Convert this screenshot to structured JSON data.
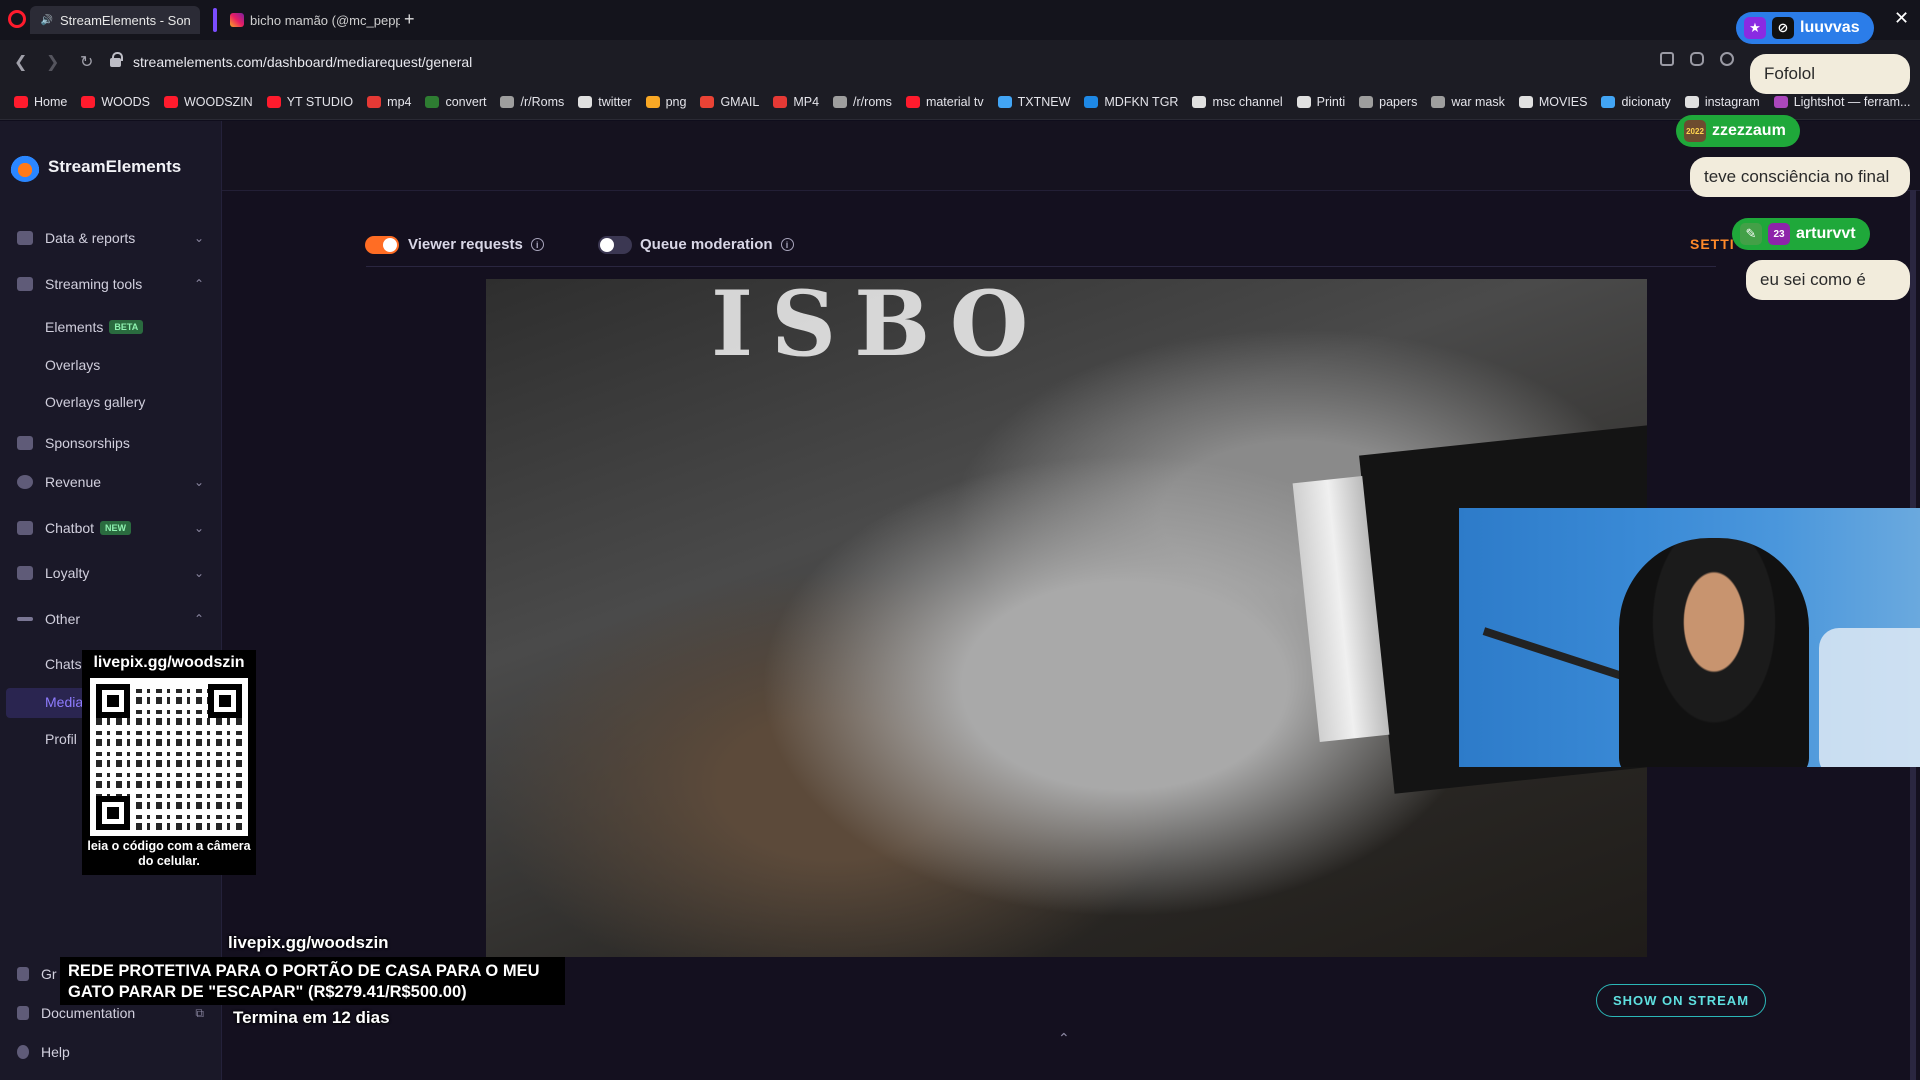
{
  "browser": {
    "tabs": [
      {
        "title": "StreamElements - Son",
        "active": true
      },
      {
        "title": "bicho mamão (@mc_pepp",
        "active": false
      }
    ],
    "new_tab": "+",
    "url": "streamelements.com/dashboard/mediarequest/general",
    "bookmarks": [
      {
        "label": "Home",
        "color": "#ff1b2d"
      },
      {
        "label": "WOODS",
        "color": "#ff1b2d"
      },
      {
        "label": "WOODSZIN",
        "color": "#ff1b2d"
      },
      {
        "label": "YT STUDIO",
        "color": "#ff1b2d"
      },
      {
        "label": "mp4",
        "color": "#e53935"
      },
      {
        "label": "convert",
        "color": "#2e7d32"
      },
      {
        "label": "/r/Roms",
        "color": "#9e9e9e"
      },
      {
        "label": "twitter",
        "color": "#e0e0e0"
      },
      {
        "label": "png",
        "color": "#f9a825"
      },
      {
        "label": "GMAIL",
        "color": "#ea4335"
      },
      {
        "label": "MP4",
        "color": "#e53935"
      },
      {
        "label": "/r/roms",
        "color": "#9e9e9e"
      },
      {
        "label": "material tv",
        "color": "#ff1b2d"
      },
      {
        "label": "TXTNEW",
        "color": "#42a5f5"
      },
      {
        "label": "MDFKN TGR",
        "color": "#1e88e5"
      },
      {
        "label": "msc channel",
        "color": "#e0e0e0"
      },
      {
        "label": "Printi",
        "color": "#e0e0e0"
      },
      {
        "label": "papers",
        "color": "#9e9e9e"
      },
      {
        "label": "war mask",
        "color": "#9e9e9e"
      },
      {
        "label": "MOVIES",
        "color": "#e0e0e0"
      },
      {
        "label": "dicionaty",
        "color": "#42a5f5"
      },
      {
        "label": "instagram",
        "color": "#e0e0e0"
      },
      {
        "label": "Lightshot — ferram...",
        "color": "#ab47bc"
      }
    ],
    "more": "»"
  },
  "dashboard": {
    "brand": "StreamElements",
    "nav": [
      {
        "label": "Data & reports",
        "icon": "chart-icon",
        "chevron": "⌄"
      },
      {
        "label": "Streaming tools",
        "icon": "tools-icon",
        "chevron": "⌃"
      },
      {
        "label": "Sponsorships",
        "icon": "star-icon"
      },
      {
        "label": "Revenue",
        "icon": "dollar-icon",
        "chevron": "⌄"
      },
      {
        "label": "Chatbot",
        "icon": "bot-icon",
        "chevron": "⌄",
        "tag": "NEW"
      },
      {
        "label": "Loyalty",
        "icon": "loyalty-icon",
        "chevron": "⌄"
      },
      {
        "label": "Other",
        "icon": "dots-icon",
        "chevron": "⌃"
      }
    ],
    "streaming_sub": [
      {
        "label": "Elements",
        "tag": "BETA"
      },
      {
        "label": "Overlays"
      },
      {
        "label": "Overlays gallery"
      }
    ],
    "other_sub": [
      {
        "label": "Chats"
      },
      {
        "label": "Media"
      },
      {
        "label": "Profil"
      }
    ],
    "bottom_nav": [
      {
        "label": "Gr"
      },
      {
        "label": "Documentation"
      },
      {
        "label": "Help"
      }
    ],
    "toggles": {
      "viewer_requests": {
        "label": "Viewer requests",
        "on": true
      },
      "queue_moderation": {
        "label": "Queue moderation",
        "on": false
      }
    },
    "settings_label": "SETTI",
    "video_title": "ISBO",
    "show_on_stream": "SHOW ON STREAM",
    "collapse": "⌃"
  },
  "overlay": {
    "qr_url": "livepix.gg/woodszin",
    "qr_caption": "leia o código com a câmera do celular.",
    "goal_url": "livepix.gg/woodszin",
    "goal_text": "REDE PROTETIVA PARA O PORTÃO DE CASA PARA O MEU GATO PARAR DE \"ESCAPAR\" (R$279.41/R$500.00)",
    "goal_ends": "Termina em 12 dias"
  },
  "chat": [
    {
      "user": "luuvvas",
      "message": "Fofolol",
      "color": "#2b7de9"
    },
    {
      "user": "zzezzaum",
      "message": "teve consciência no final",
      "color": "#1fa83a",
      "badge": "2022"
    },
    {
      "user": "arturvvt",
      "message": "eu sei como é",
      "color": "#1fa83a",
      "badge": "23"
    }
  ]
}
